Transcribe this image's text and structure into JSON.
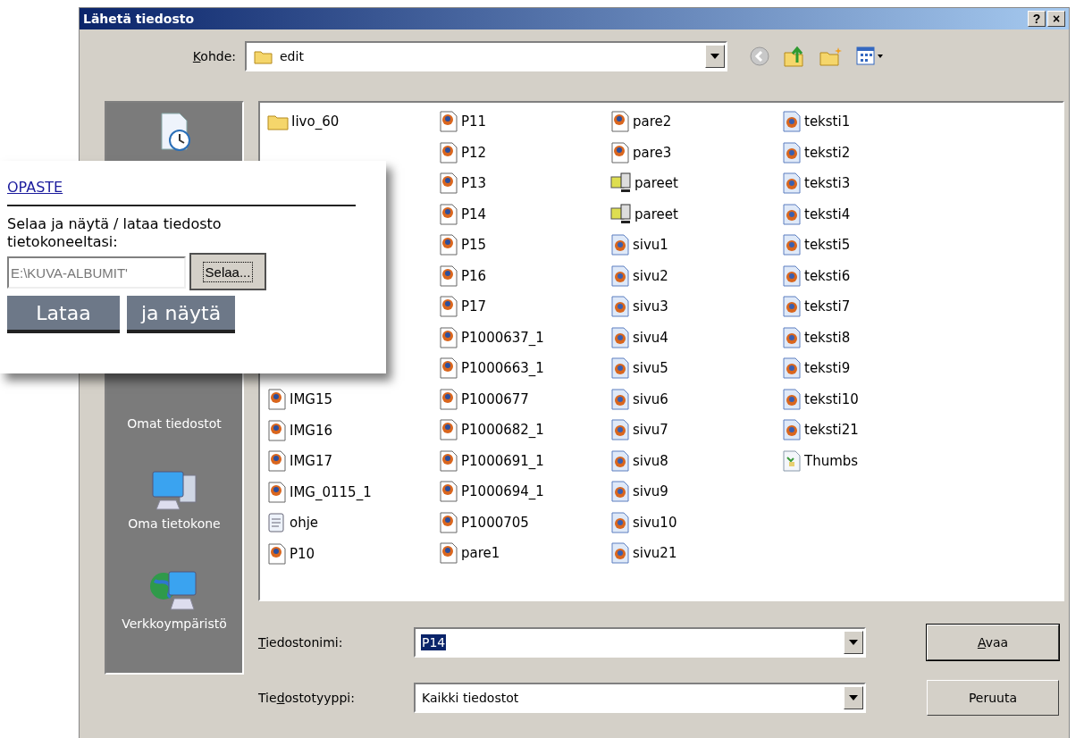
{
  "window": {
    "title": "Lähetä tiedosto",
    "help": "?",
    "close": "×"
  },
  "location": {
    "key": "K",
    "label_post": "ohde:",
    "value": "edit"
  },
  "toolbar": [
    {
      "kind": "back"
    },
    {
      "kind": "up"
    },
    {
      "kind": "new-folder"
    },
    {
      "kind": "views"
    }
  ],
  "places": [
    {
      "kind": "recent"
    },
    {
      "kind": "documents",
      "label": "Omat tiedostot"
    },
    {
      "kind": "computer",
      "label": "Oma tietokone"
    },
    {
      "kind": "network",
      "label": "Verkkoympäristö"
    }
  ],
  "file_columns": [
    [
      {
        "name": "Iivo_60",
        "kind": "folder"
      },
      {
        "name": "IMG15",
        "kind": "web"
      },
      {
        "name": "IMG16",
        "kind": "web"
      },
      {
        "name": "IMG17",
        "kind": "web"
      },
      {
        "name": "IMG_0115_1",
        "kind": "web"
      },
      {
        "name": "ohje",
        "kind": "text"
      },
      {
        "name": "P10",
        "kind": "web"
      }
    ],
    [
      {
        "name": "P11",
        "kind": "web"
      },
      {
        "name": "P12",
        "kind": "web"
      },
      {
        "name": "P13",
        "kind": "web"
      },
      {
        "name": "P14",
        "kind": "web"
      },
      {
        "name": "P15",
        "kind": "web"
      },
      {
        "name": "P16",
        "kind": "web"
      },
      {
        "name": "P17",
        "kind": "web"
      },
      {
        "name": "P1000637_1",
        "kind": "web"
      },
      {
        "name": "P1000663_1",
        "kind": "web"
      },
      {
        "name": "P1000677",
        "kind": "web"
      },
      {
        "name": "P1000682_1",
        "kind": "web"
      },
      {
        "name": "P1000691_1",
        "kind": "web"
      },
      {
        "name": "P1000694_1",
        "kind": "web"
      },
      {
        "name": "P1000705",
        "kind": "web"
      },
      {
        "name": "pare1",
        "kind": "web"
      }
    ],
    [
      {
        "name": "pare2",
        "kind": "web"
      },
      {
        "name": "pare3",
        "kind": "web"
      },
      {
        "name": "pareet",
        "kind": "shared-folder"
      },
      {
        "name": "pareet",
        "kind": "shared-folder"
      },
      {
        "name": "sivu1",
        "kind": "page"
      },
      {
        "name": "sivu2",
        "kind": "page"
      },
      {
        "name": "sivu3",
        "kind": "page"
      },
      {
        "name": "sivu4",
        "kind": "page"
      },
      {
        "name": "sivu5",
        "kind": "page"
      },
      {
        "name": "sivu6",
        "kind": "page"
      },
      {
        "name": "sivu7",
        "kind": "page"
      },
      {
        "name": "sivu8",
        "kind": "page"
      },
      {
        "name": "sivu9",
        "kind": "page"
      },
      {
        "name": "sivu10",
        "kind": "page"
      },
      {
        "name": "sivu21",
        "kind": "page"
      }
    ],
    [
      {
        "name": "teksti1",
        "kind": "page"
      },
      {
        "name": "teksti2",
        "kind": "page"
      },
      {
        "name": "teksti3",
        "kind": "page"
      },
      {
        "name": "teksti4",
        "kind": "page"
      },
      {
        "name": "teksti5",
        "kind": "page"
      },
      {
        "name": "teksti6",
        "kind": "page"
      },
      {
        "name": "teksti7",
        "kind": "page"
      },
      {
        "name": "teksti8",
        "kind": "page"
      },
      {
        "name": "teksti9",
        "kind": "page"
      },
      {
        "name": "teksti10",
        "kind": "page"
      },
      {
        "name": "teksti21",
        "kind": "page"
      },
      {
        "name": "Thumbs",
        "kind": "thumbs"
      }
    ]
  ],
  "fields": [
    {
      "key": "T",
      "label_post": "iedostonimi:",
      "value": "P14",
      "highlighted": true
    },
    {
      "label_pre": "Tie",
      "key": "d",
      "label_post": "ostotyyppi:",
      "value": "Kaikki tiedostot",
      "highlighted": false
    }
  ],
  "buttons": [
    {
      "key": "A",
      "label_post": "vaa",
      "default": true
    },
    {
      "label_post": "Peruuta",
      "default": false
    }
  ],
  "overlay": {
    "link": "OPASTE",
    "text": "Selaa ja näytä / lataa tiedosto tietokoneeltasi:",
    "path": "E:\\KUVA-ALBUMIT'",
    "browse": "Selaa...",
    "actions": [
      "Lataa",
      "ja näytä"
    ]
  }
}
